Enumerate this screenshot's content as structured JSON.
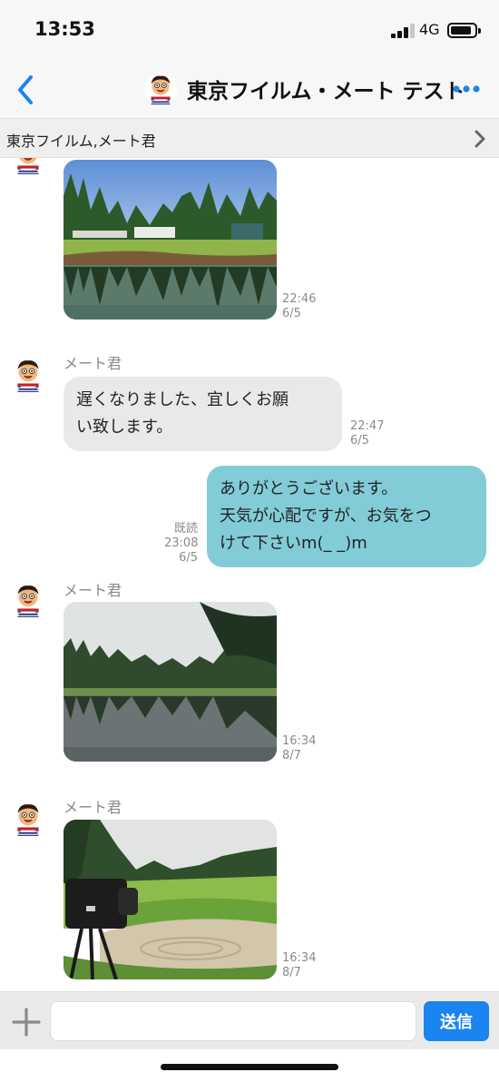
{
  "status_bar": {
    "time": "13:53",
    "network": "4G",
    "icons": [
      "cellular-signal-icon",
      "battery-icon"
    ]
  },
  "header": {
    "title": "東京フイルム・メート テスト",
    "back_icon": "chevron-left-icon",
    "more_icon": "more-dots-icon",
    "accent": "#1a84f0"
  },
  "members_bar": {
    "label": "東京フイルム,メート君",
    "icon": "chevron-right-icon"
  },
  "messages": [
    {
      "type": "image",
      "direction": "in",
      "photo": "golf-course-pond",
      "time": "22:46",
      "date": "6/5"
    },
    {
      "type": "text",
      "direction": "in",
      "sender": "メート君",
      "lines": [
        "遅くなりました、宜しくお願",
        "い致します。"
      ],
      "time": "22:47",
      "date": "6/5"
    },
    {
      "type": "text",
      "direction": "out",
      "lines": [
        "ありがとうございます。",
        "天気が心配ですが、お気をつ",
        "けて下さいm(_ _)m"
      ],
      "read": "既読",
      "time": "23:08",
      "date": "6/5",
      "bubble_color": "#82ccd8"
    },
    {
      "type": "image",
      "direction": "in",
      "sender": "メート君",
      "photo": "forest-lake",
      "time": "16:34",
      "date": "8/7"
    },
    {
      "type": "image",
      "direction": "in",
      "sender": "メート君",
      "photo": "golf-green-with-camera",
      "time": "16:34",
      "date": "8/7"
    }
  ],
  "composer": {
    "placeholder": "",
    "send_label": "送信",
    "plus_icon": "plus-icon"
  }
}
